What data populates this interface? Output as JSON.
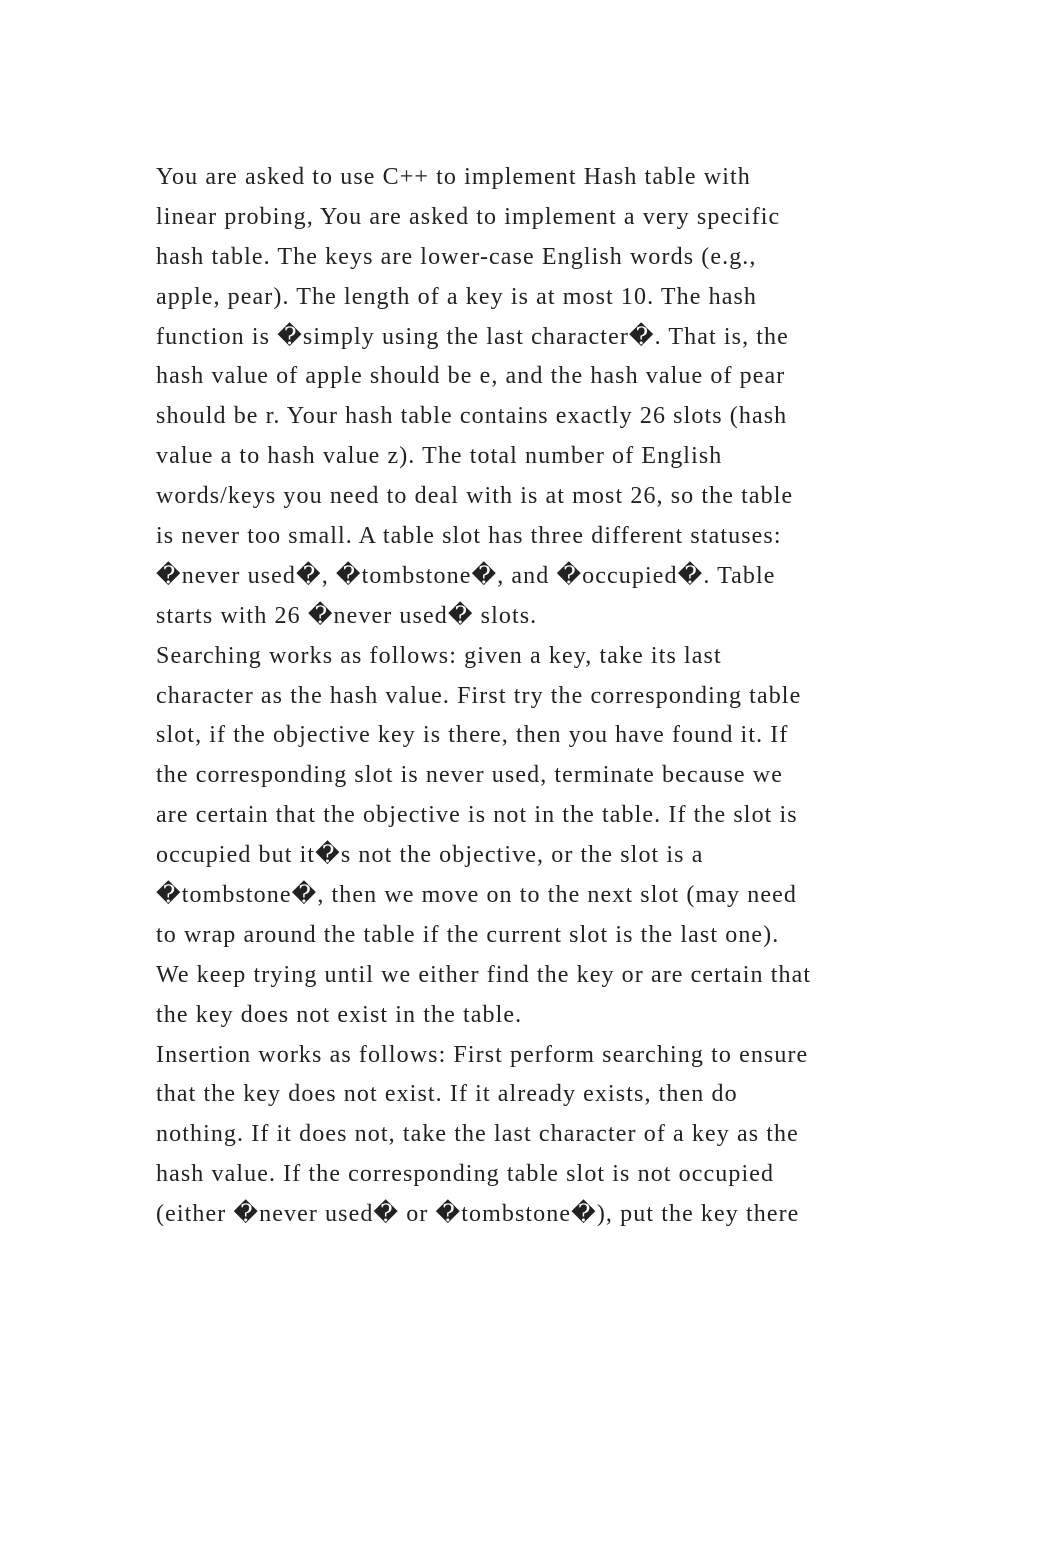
{
  "document": {
    "paragraphs": [
      {
        "lines": [
          "You are asked to use C++ to implement Hash table with",
          "linear probing, You are asked to implement a very specific",
          "hash table. The keys are lower-case English words (e.g.,",
          "apple, pear). The length of a key is at most 10. The hash",
          "function is �simply using the last character�. That is, the",
          "hash value of apple should be e, and the hash value of pear",
          "should be r. Your hash table contains exactly 26 slots (hash",
          "value a to hash value z). The total number of English",
          "words/keys you need to deal with is at most 26, so the table",
          "is never too small. A table slot has three different statuses:",
          "�never used�, �tombstone�, and �occupied�. Table",
          "starts with 26 �never used� slots."
        ]
      },
      {
        "lines": [
          "Searching works as follows: given a key, take its last",
          "character as the hash value. First try the corresponding table",
          "slot, if the objective key is there, then you have found it. If",
          "the corresponding slot is never used, terminate because we",
          "are certain that the objective is not in the table. If the slot is",
          "occupied but it�s not the objective, or the slot is a",
          "�tombstone�, then we move on to the next slot (may need",
          "to wrap around the table if the current slot is the last one).",
          "We keep trying until we either find the key or are certain that",
          "the key does not exist in the table."
        ]
      },
      {
        "lines": [
          "Insertion works as follows: First perform searching to ensure",
          "that the key does not exist. If it already exists, then do",
          "nothing. If it does not, take the last character of a key as the",
          "hash value. If the corresponding table slot is not occupied",
          "(either �never used� or �tombstone�), put the key there"
        ]
      }
    ]
  }
}
